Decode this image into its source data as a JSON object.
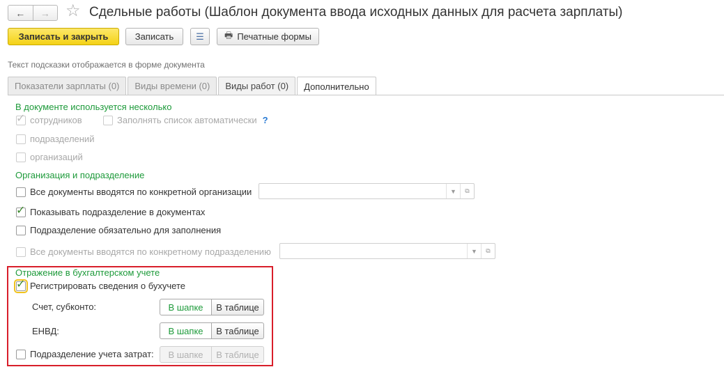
{
  "header": {
    "back_icon": "←",
    "forward_icon": "→",
    "favorite_icon": "☆",
    "title": "Сдельные работы (Шаблон документа ввода исходных данных для расчета зарплаты)"
  },
  "toolbar": {
    "save_close": "Записать и закрыть",
    "save": "Записать",
    "list_icon": "☰",
    "print_icon": "🖶",
    "print_forms": "Печатные формы"
  },
  "hint": "Текст подсказки отображается в форме документа",
  "tabs": [
    {
      "label": "Показатели зарплаты (0)"
    },
    {
      "label": "Виды времени (0)"
    },
    {
      "label": "Виды работ (0)"
    },
    {
      "label": "Дополнительно"
    }
  ],
  "section1": {
    "title": "В документе используется несколько",
    "employees": "сотрудников",
    "autofill": "Заполнять список автоматически",
    "help": "?",
    "departments": "подразделений",
    "organizations": "организаций"
  },
  "section2": {
    "title": "Организация и подразделение",
    "all_by_org": "Все документы вводятся по конкретной организации",
    "show_department": "Показывать подразделение в документах",
    "department_required": "Подразделение обязательно для заполнения",
    "all_by_department": "Все документы вводятся по конкретному подразделению"
  },
  "section3": {
    "title": "Отражение в бухгалтерском учете",
    "register": "Регистрировать сведения о бухучете",
    "account_label": "Счет, субконто:",
    "envd_label": "ЕНВД:",
    "cost_dept_label": "Подразделение учета затрат:",
    "in_header": "В шапке",
    "in_table": "В таблице"
  },
  "field_icons": {
    "dropdown": "▼",
    "open": "⧉"
  },
  "colors": {
    "accent_green": "#1d9a3a",
    "primary_yellow": "#f4d216",
    "highlight_red": "#d81e2a"
  }
}
